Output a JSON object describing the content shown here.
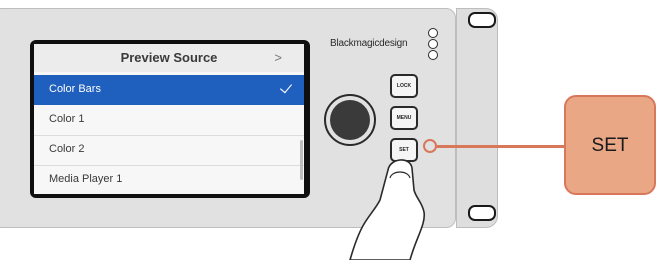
{
  "lcd": {
    "title": "Preview Source",
    "chevron": ">",
    "items": [
      {
        "label": "Color Bars",
        "selected": true
      },
      {
        "label": "Color 1",
        "selected": false
      },
      {
        "label": "Color 2",
        "selected": false
      },
      {
        "label": "Media Player 1",
        "selected": false
      }
    ]
  },
  "brand": "Blackmagicdesign",
  "buttons": {
    "lock": "LOCK",
    "menu": "MENU",
    "set": "SET"
  },
  "callout": {
    "label": "SET",
    "color": "#e9a786",
    "border_color": "#d9775a"
  },
  "colors": {
    "selection": "#1f5fbd"
  },
  "icons": [
    "check-icon",
    "chevron-right-icon",
    "brand-logo-icon",
    "hand-pointer-icon"
  ]
}
